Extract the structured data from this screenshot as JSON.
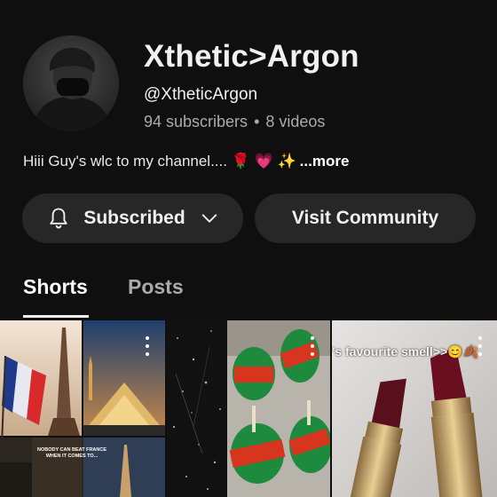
{
  "channel": {
    "name": "Xthetic>Argon",
    "handle": "@XtheticArgon",
    "subscribers": "94 subscribers",
    "separator": "•",
    "videos": "8 videos",
    "description": "Hiii Guy's wlc to my channel.... 🌹 💗 ✨",
    "more_label": "...more"
  },
  "actions": {
    "subscribe_label": "Subscribed",
    "visit_label": "Visit Community"
  },
  "tabs": [
    {
      "label": "Shorts",
      "active": true
    },
    {
      "label": "Posts",
      "active": false
    }
  ],
  "shorts": [
    {
      "caption": "NOBODY CAN BEAT FRANCE WHEN IT COMES TO..."
    },
    {
      "caption": ""
    },
    {
      "caption": "'s favourite smell>>😊🍂"
    }
  ],
  "colors": {
    "background": "#0f0f0f",
    "button_bg": "#272727",
    "text_primary": "#f1f1f1",
    "text_secondary": "#aaaaaa"
  },
  "icons": [
    "bell-icon",
    "chevron-down-icon",
    "more-vert-icon"
  ]
}
